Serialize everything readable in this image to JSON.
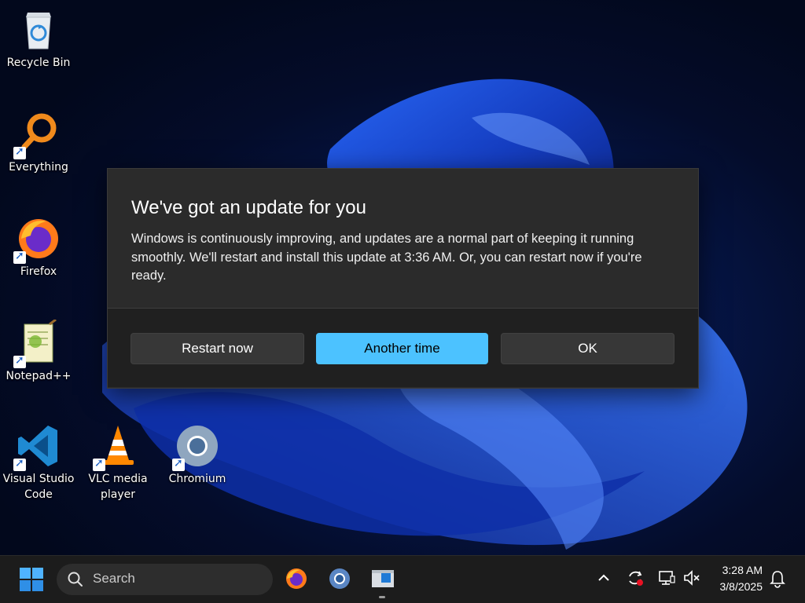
{
  "desktop": {
    "icons": [
      {
        "label": "Recycle Bin",
        "icon": "recycle-bin-icon"
      },
      {
        "label": "Everything",
        "icon": "everything-search-icon"
      },
      {
        "label": "Firefox",
        "icon": "firefox-icon"
      },
      {
        "label": "Notepad++",
        "icon": "notepad-plus-plus-icon"
      },
      {
        "label": "Visual Studio Code",
        "icon": "vscode-icon"
      },
      {
        "label": "VLC media player",
        "icon": "vlc-icon"
      },
      {
        "label": "Chromium",
        "icon": "chromium-icon"
      }
    ]
  },
  "dialog": {
    "title": "We've got an update for you",
    "message": "Windows is continuously improving, and updates are a normal part of keeping it running smoothly. We'll restart and install this update at 3:36 AM. Or, you can restart now if you're ready.",
    "buttons": {
      "restart_now": "Restart now",
      "another_time": "Another time",
      "ok": "OK"
    },
    "accent_color": "#4cc2ff"
  },
  "taskbar": {
    "search_placeholder": "Search",
    "pinned": [
      "firefox-icon",
      "chromium-icon",
      "file-explorer-icon"
    ],
    "tray_icons": [
      "chevron-up-icon",
      "sync-alert-icon",
      "network-icon",
      "volume-muted-icon",
      "notification-bell-icon"
    ],
    "time": "3:28 AM",
    "date": "3/8/2025"
  }
}
